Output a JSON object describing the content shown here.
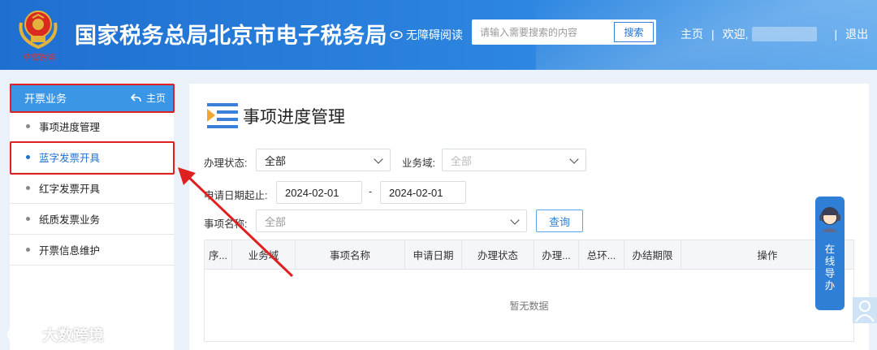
{
  "header": {
    "emblem_caption": "中国税务",
    "site_title": "国家税务总局北京市电子税务局",
    "accessibility_label": "无障碍阅读",
    "search_placeholder": "请输入需要搜索的内容",
    "search_button": "搜索",
    "home_link": "主页",
    "welcome": "欢迎,",
    "logout": "退出",
    "separator": "|"
  },
  "sidebar": {
    "section_title": "开票业务",
    "home_label": "主页",
    "items": [
      {
        "label": "事项进度管理",
        "active": false
      },
      {
        "label": "蓝字发票开具",
        "active": true
      },
      {
        "label": "红字发票开具",
        "active": false
      },
      {
        "label": "纸质发票业务",
        "active": false
      },
      {
        "label": "开票信息维护",
        "active": false
      }
    ]
  },
  "main": {
    "title": "事项进度管理",
    "filters": {
      "status_label": "办理状态:",
      "status_value": "全部",
      "domain_label": "业务域:",
      "domain_placeholder": "全部",
      "date_label": "申请日期起止:",
      "date_from": "2024-02-01",
      "date_sep": "-",
      "date_to": "2024-02-01",
      "item_label": "事项名称:",
      "item_placeholder": "全部",
      "query_button": "查询"
    },
    "table": {
      "columns": [
        "序...",
        "业务域",
        "事项名称",
        "申请日期",
        "办理状态",
        "办理...",
        "总环...",
        "办结期限",
        "操作"
      ],
      "empty_text": "暂无数据"
    }
  },
  "guide": {
    "label": "在线导办"
  },
  "watermark": {
    "text": "大数跨境"
  },
  "colors": {
    "header_blue": "#1f6fd0",
    "accent_blue": "#3b97e6",
    "highlight_red": "#e02020"
  }
}
